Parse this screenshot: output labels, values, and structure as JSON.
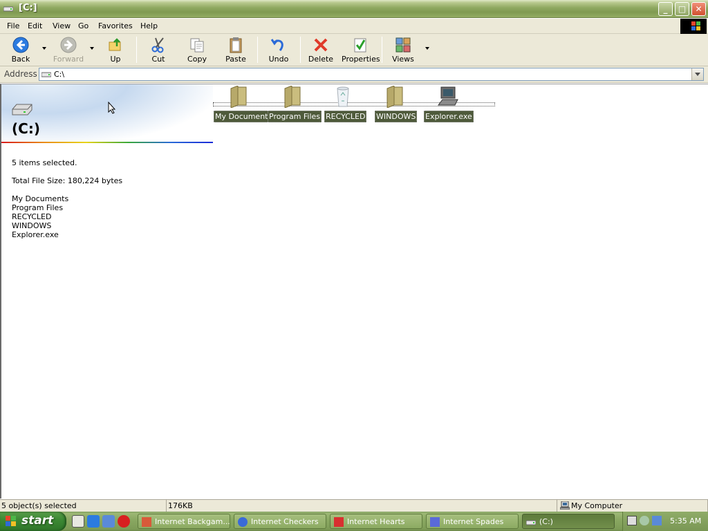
{
  "window": {
    "title": "[C:]"
  },
  "menu": {
    "file": "File",
    "edit": "Edit",
    "view": "View",
    "go": "Go",
    "favorites": "Favorites",
    "help": "Help"
  },
  "toolbar": {
    "back": "Back",
    "forward": "Forward",
    "up": "Up",
    "cut": "Cut",
    "copy": "Copy",
    "paste": "Paste",
    "undo": "Undo",
    "delete": "Delete",
    "properties": "Properties",
    "views": "Views"
  },
  "address": {
    "label": "Address",
    "value": "C:\\"
  },
  "webview": {
    "heading": "(C:)",
    "selected_count": "5 items selected.",
    "total_size": "Total File Size: 180,224 bytes",
    "items": [
      "My Documents",
      "Program Files",
      "RECYCLED",
      "WINDOWS",
      "Explorer.exe"
    ]
  },
  "files": [
    {
      "name": "My Documents",
      "icon": "folder-icon"
    },
    {
      "name": "Program Files",
      "icon": "folder-icon"
    },
    {
      "name": "RECYCLED",
      "icon": "recycle-bin-icon"
    },
    {
      "name": "WINDOWS",
      "icon": "folder-icon"
    },
    {
      "name": "Explorer.exe",
      "icon": "computer-exe-icon"
    }
  ],
  "status": {
    "objects": "5 object(s) selected",
    "size": "176KB",
    "zone": "My Computer"
  },
  "taskbar": {
    "start": "start",
    "tasks": [
      {
        "label": "Internet Backgam...",
        "icon": "backgammon-icon"
      },
      {
        "label": "Internet Checkers",
        "icon": "checkers-icon"
      },
      {
        "label": "Internet Hearts",
        "icon": "hearts-icon"
      },
      {
        "label": "Internet Spades",
        "icon": "spades-icon"
      },
      {
        "label": "(C:)",
        "icon": "drive-icon"
      }
    ],
    "clock": "5:35 AM"
  },
  "colors": {
    "title_bar": "#8fa860",
    "selection": "#4e5a3a",
    "taskbar": "#8aa862",
    "start_button": "#3d8a35"
  }
}
